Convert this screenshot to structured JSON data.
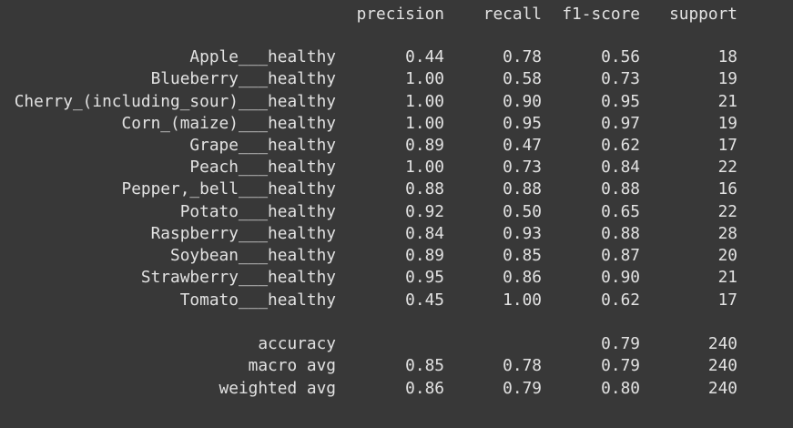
{
  "headers": {
    "precision": "precision",
    "recall": "recall",
    "f1_score": "f1-score",
    "support": "support"
  },
  "classes": [
    {
      "label": "Apple___healthy",
      "precision": "0.44",
      "recall": "0.78",
      "f1": "0.56",
      "support": "18"
    },
    {
      "label": "Blueberry___healthy",
      "precision": "1.00",
      "recall": "0.58",
      "f1": "0.73",
      "support": "19"
    },
    {
      "label": "Cherry_(including_sour)___healthy",
      "precision": "1.00",
      "recall": "0.90",
      "f1": "0.95",
      "support": "21"
    },
    {
      "label": "Corn_(maize)___healthy",
      "precision": "1.00",
      "recall": "0.95",
      "f1": "0.97",
      "support": "19"
    },
    {
      "label": "Grape___healthy",
      "precision": "0.89",
      "recall": "0.47",
      "f1": "0.62",
      "support": "17"
    },
    {
      "label": "Peach___healthy",
      "precision": "1.00",
      "recall": "0.73",
      "f1": "0.84",
      "support": "22"
    },
    {
      "label": "Pepper,_bell___healthy",
      "precision": "0.88",
      "recall": "0.88",
      "f1": "0.88",
      "support": "16"
    },
    {
      "label": "Potato___healthy",
      "precision": "0.92",
      "recall": "0.50",
      "f1": "0.65",
      "support": "22"
    },
    {
      "label": "Raspberry___healthy",
      "precision": "0.84",
      "recall": "0.93",
      "f1": "0.88",
      "support": "28"
    },
    {
      "label": "Soybean___healthy",
      "precision": "0.89",
      "recall": "0.85",
      "f1": "0.87",
      "support": "20"
    },
    {
      "label": "Strawberry___healthy",
      "precision": "0.95",
      "recall": "0.86",
      "f1": "0.90",
      "support": "21"
    },
    {
      "label": "Tomato___healthy",
      "precision": "0.45",
      "recall": "1.00",
      "f1": "0.62",
      "support": "17"
    }
  ],
  "summary": [
    {
      "label": "accuracy",
      "precision": "",
      "recall": "",
      "f1": "0.79",
      "support": "240"
    },
    {
      "label": "macro avg",
      "precision": "0.85",
      "recall": "0.78",
      "f1": "0.79",
      "support": "240"
    },
    {
      "label": "weighted avg",
      "precision": "0.86",
      "recall": "0.79",
      "f1": "0.80",
      "support": "240"
    }
  ]
}
